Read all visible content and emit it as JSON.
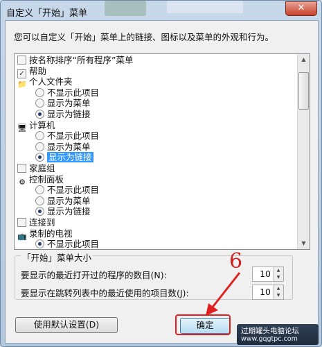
{
  "window": {
    "title": "自定义「开始」菜单",
    "close_label": "✕"
  },
  "description": "您可以自定义「开始」菜单上的链接、图标以及菜单的外观和行为。",
  "list": {
    "items": [
      {
        "type": "checkbox",
        "checked": false,
        "label": "按名称排序“所有程序”菜单"
      },
      {
        "type": "checkbox",
        "checked": true,
        "label": "帮助"
      },
      {
        "type": "header",
        "icon": "user-folder-icon",
        "label": "个人文件夹"
      },
      {
        "type": "radio",
        "checked": false,
        "label": "不显示此项目"
      },
      {
        "type": "radio",
        "checked": false,
        "label": "显示为菜单"
      },
      {
        "type": "radio",
        "checked": true,
        "label": "显示为链接"
      },
      {
        "type": "header",
        "icon": "computer-icon",
        "label": "计算机"
      },
      {
        "type": "radio",
        "checked": false,
        "label": "不显示此项目"
      },
      {
        "type": "radio",
        "checked": false,
        "label": "显示为菜单"
      },
      {
        "type": "radio",
        "checked": true,
        "label": "显示为链接",
        "selected": true
      },
      {
        "type": "checkbox",
        "checked": false,
        "label": "家庭组"
      },
      {
        "type": "header",
        "icon": "control-panel-icon",
        "label": "控制面板"
      },
      {
        "type": "radio",
        "checked": false,
        "label": "不显示此项目"
      },
      {
        "type": "radio",
        "checked": false,
        "label": "显示为菜单"
      },
      {
        "type": "radio",
        "checked": true,
        "label": "显示为链接"
      },
      {
        "type": "checkbox",
        "checked": false,
        "label": "连接到"
      },
      {
        "type": "header",
        "icon": "recorded-tv-icon",
        "label": "录制的电视"
      },
      {
        "type": "radio",
        "checked": true,
        "label": "不显示此项目"
      }
    ]
  },
  "menu_size": {
    "legend": "「开始」菜单大小",
    "recent_programs_label": "要显示的最近打开过的程序的数目(N):",
    "recent_programs_value": "10",
    "jump_list_label": "要显示在跳转列表中的最近使用的项目数(J):",
    "jump_list_value": "10"
  },
  "buttons": {
    "defaults": "使用默认设置(D)",
    "ok": "确定"
  },
  "annotation": {
    "step": "6"
  },
  "watermark": {
    "line1": "过期罐头电脑论坛",
    "line2": "www.gqgtpc.com"
  }
}
